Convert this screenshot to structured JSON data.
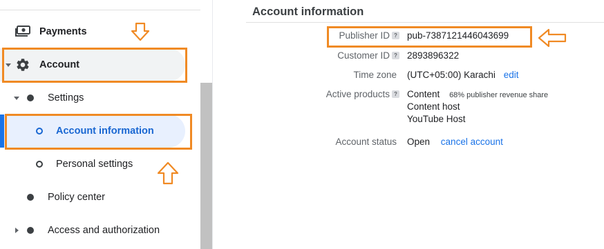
{
  "sidebar": {
    "payments_label": "Payments",
    "account_label": "Account",
    "settings_label": "Settings",
    "account_information_label": "Account information",
    "personal_settings_label": "Personal settings",
    "policy_center_label": "Policy center",
    "access_label": "Access and authorization"
  },
  "main": {
    "title": "Account information",
    "publisher_id": {
      "label": "Publisher ID",
      "value": "pub-7387121446043699"
    },
    "customer_id": {
      "label": "Customer ID",
      "value": "2893896322"
    },
    "time_zone": {
      "label": "Time zone",
      "value": "(UTC+05:00) Karachi",
      "edit_label": "edit"
    },
    "active_products": {
      "label": "Active products",
      "items": [
        "Content",
        "Content host",
        "YouTube Host"
      ],
      "revenue_share": "68% publisher revenue share"
    },
    "account_status": {
      "label": "Account status",
      "value": "Open",
      "cancel_label": "cancel account"
    }
  },
  "icons": {
    "payments": "payments-icon",
    "account": "gear-icon",
    "help": "help-icon",
    "annotation_arrow": "arrow-icon"
  },
  "colors": {
    "highlight": "#f08a24",
    "active_blue": "#1967d2",
    "link_blue": "#1a73e8"
  }
}
